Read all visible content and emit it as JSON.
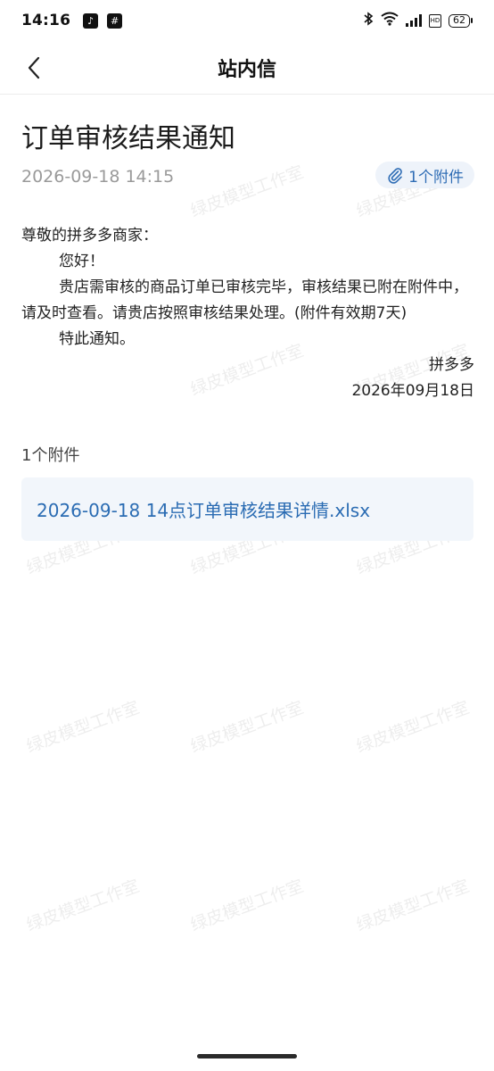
{
  "status_bar": {
    "time": "14:16",
    "app_icons": [
      "tiktok-icon",
      "hash-app-icon"
    ],
    "battery": "62"
  },
  "nav": {
    "title": "站内信",
    "back_icon": "chevron-left-icon"
  },
  "message": {
    "title": "订单审核结果通知",
    "datetime": "2026-09-18 14:15",
    "attachment_chip": "1个附件",
    "greeting": "尊敬的拼多多商家：",
    "hello": "您好！",
    "paragraph": "贵店需审核的商品订单已审核完毕，审核结果已附在附件中，请及时查看。请贵店按照审核结果处理。(附件有效期7天)",
    "closing": "特此通知。",
    "signature": "拼多多",
    "sign_date": "2026年09月18日"
  },
  "attachments": {
    "heading": "1个附件",
    "files": [
      {
        "name": "2026-09-18 14点订单审核结果详情.xlsx"
      }
    ]
  },
  "watermark_text": "绿皮模型工作室",
  "colors": {
    "link": "#2b6cb3",
    "chip_bg": "#eef3fa",
    "file_card_bg": "#f2f6fb",
    "muted": "#9a9a9a"
  }
}
